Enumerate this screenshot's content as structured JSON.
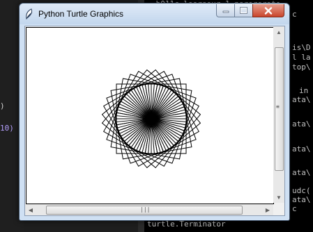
{
  "editor": {
    "lines": [
      {
        "text": ")"
      },
      {
        "text": "10)"
      }
    ]
  },
  "console": {
    "lines": [
      {
        "text": ".b011c.loorsour.1_nsrorsrato"
      },
      {
        "text": "c"
      },
      {
        "text": "is\\D"
      },
      {
        "text": "l la"
      },
      {
        "text": "top\\"
      },
      {
        "text": "in"
      },
      {
        "text": "ata\\"
      },
      {
        "text": "ata\\"
      },
      {
        "text": "ata\\"
      },
      {
        "text": "ata\\"
      },
      {
        "text": "udc("
      },
      {
        "text": "ata\\"
      },
      {
        "text": "c"
      },
      {
        "text": "turtle.Terminator"
      }
    ]
  },
  "window": {
    "title": "Python Turtle Graphics",
    "icon": "feather-icon",
    "buttons": {
      "minimize": "minimize-icon",
      "maximize": "maximize-icon",
      "close": "close-icon"
    }
  },
  "drawing": {
    "shape": "rotated squares and spokes",
    "square_count": 36,
    "rotation_step_deg": 10,
    "stroke_color": "#000000",
    "background_color": "#ffffff"
  },
  "scrollbars": {
    "vertical_grip": "≡",
    "horizontal_grip": "|||"
  }
}
